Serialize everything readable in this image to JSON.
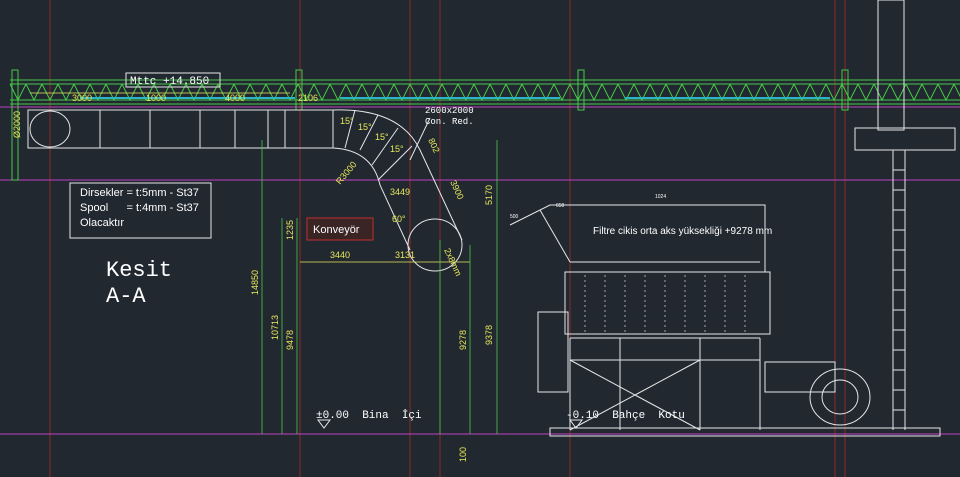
{
  "drawing": {
    "elevation_tag": "Mttc +14.850",
    "top_dims": [
      "3000",
      "1000",
      "4000",
      "2106"
    ],
    "diameter_label": "Ø2000",
    "duct_size_label": "2600x2000",
    "duct_note": "Con. Red.",
    "bend_angles": [
      "15°",
      "15°",
      "15°",
      "15°"
    ],
    "radius_label": "R3000",
    "bend_dims": [
      "3449",
      "3900",
      "802",
      "60°",
      "2x8mm"
    ],
    "horizontal_dims": [
      "3440",
      "3131"
    ],
    "vertical_dims": [
      "1235",
      "14850",
      "10713",
      "9478",
      "5170",
      "9278",
      "9378",
      "100"
    ],
    "notes": [
      "Dirsekler = t:5mm - St37",
      "Spool      = t:4mm - St37",
      "Olacaktır"
    ],
    "conveyor_label": "Konveyör",
    "section_title": [
      "Kesit",
      "A-A"
    ],
    "filter_note": "Filtre cikis orta aks yüksekliği +9278 mm",
    "level_inside": "±0.00  Bina  İçi",
    "level_garden": "-0.10  Bahçe  Kotu",
    "small_dims": [
      "500",
      "650",
      "1024"
    ]
  },
  "colors": {
    "background": "#212830",
    "green": "#49c94a",
    "magenta": "#c040c0",
    "red": "#c03030",
    "white": "#e6e6e6",
    "yellow": "#e8e85a",
    "cyan": "#2bb3c9"
  }
}
